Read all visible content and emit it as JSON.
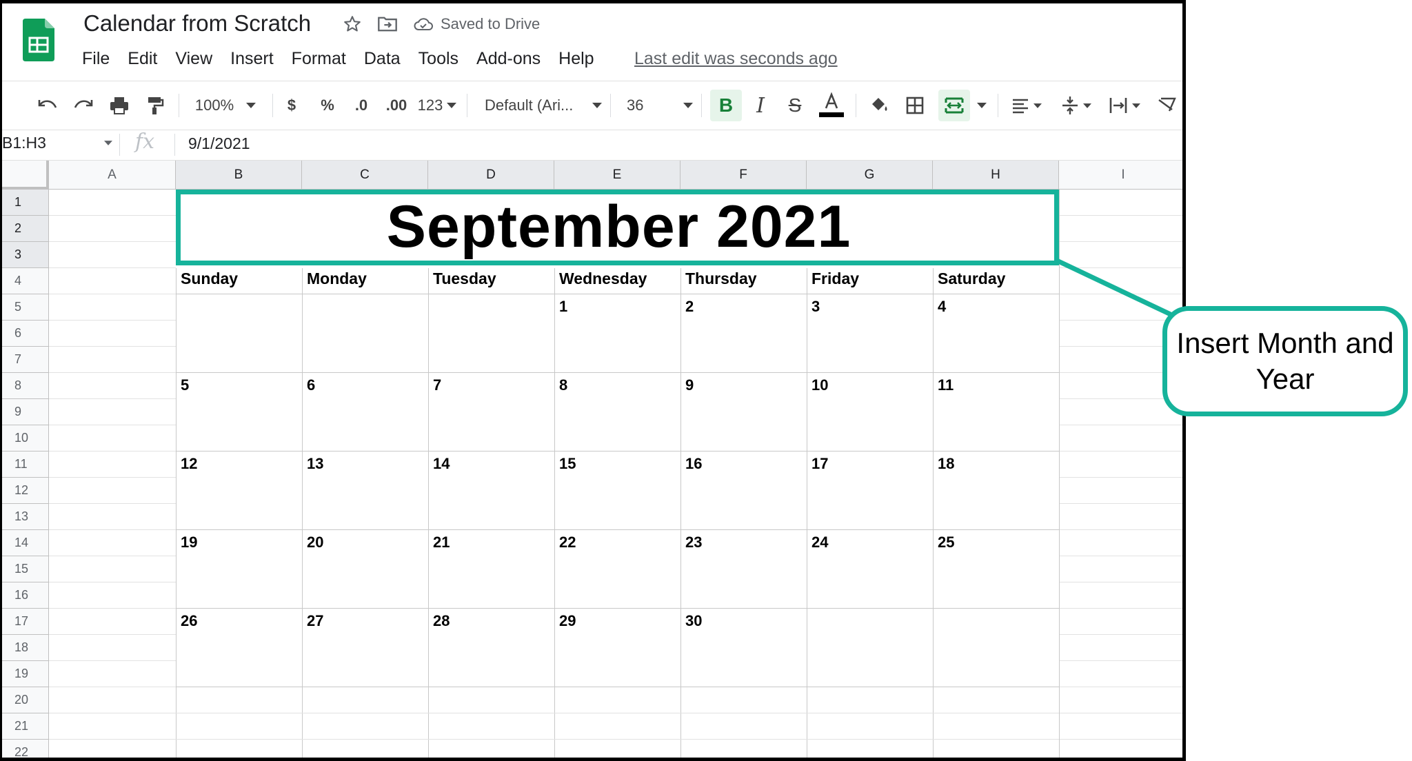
{
  "doc": {
    "title": "Calendar from Scratch",
    "saved_status": "Saved to Drive",
    "last_edit": "Last edit was seconds ago"
  },
  "menu": [
    "File",
    "Edit",
    "View",
    "Insert",
    "Format",
    "Data",
    "Tools",
    "Add-ons",
    "Help"
  ],
  "toolbar": {
    "zoom": "100%",
    "currency": "$",
    "percent": "%",
    "decrease_decimal": ".0",
    "increase_decimal": ".00",
    "more_formats": "123",
    "font": "Default (Ari...",
    "font_size": "36"
  },
  "formula_bar": {
    "name_box": "B1:H3",
    "fx": "fx",
    "value": "9/1/2021"
  },
  "columns": [
    "A",
    "B",
    "C",
    "D",
    "E",
    "F",
    "G",
    "H",
    "I"
  ],
  "rows": [
    "1",
    "2",
    "3",
    "4",
    "5",
    "6",
    "7",
    "8",
    "9",
    "10",
    "11",
    "12",
    "13",
    "14",
    "15",
    "16",
    "17",
    "18",
    "19",
    "20",
    "21",
    "22"
  ],
  "calendar": {
    "title": "September 2021",
    "day_names": [
      "Sunday",
      "Monday",
      "Tuesday",
      "Wednesday",
      "Thursday",
      "Friday",
      "Saturday"
    ],
    "weeks": [
      [
        "",
        "",
        "",
        "1",
        "2",
        "3",
        "4"
      ],
      [
        "5",
        "6",
        "7",
        "8",
        "9",
        "10",
        "11"
      ],
      [
        "12",
        "13",
        "14",
        "15",
        "16",
        "17",
        "18"
      ],
      [
        "19",
        "20",
        "21",
        "22",
        "23",
        "24",
        "25"
      ],
      [
        "26",
        "27",
        "28",
        "29",
        "30",
        "",
        ""
      ]
    ]
  },
  "callout": {
    "text": "Insert Month and Year"
  },
  "colors": {
    "accent": "#16b39b",
    "sheets_green": "#0f9d58",
    "bold_active": "#188038"
  },
  "icons": [
    "sheets-logo-icon",
    "star-icon",
    "move-folder-icon",
    "cloud-icon",
    "undo-icon",
    "redo-icon",
    "print-icon",
    "paint-format-icon",
    "text-color-icon",
    "fill-color-icon",
    "borders-icon",
    "merge-cells-icon",
    "align-icon",
    "valign-icon",
    "text-wrap-icon",
    "text-rotate-icon"
  ]
}
